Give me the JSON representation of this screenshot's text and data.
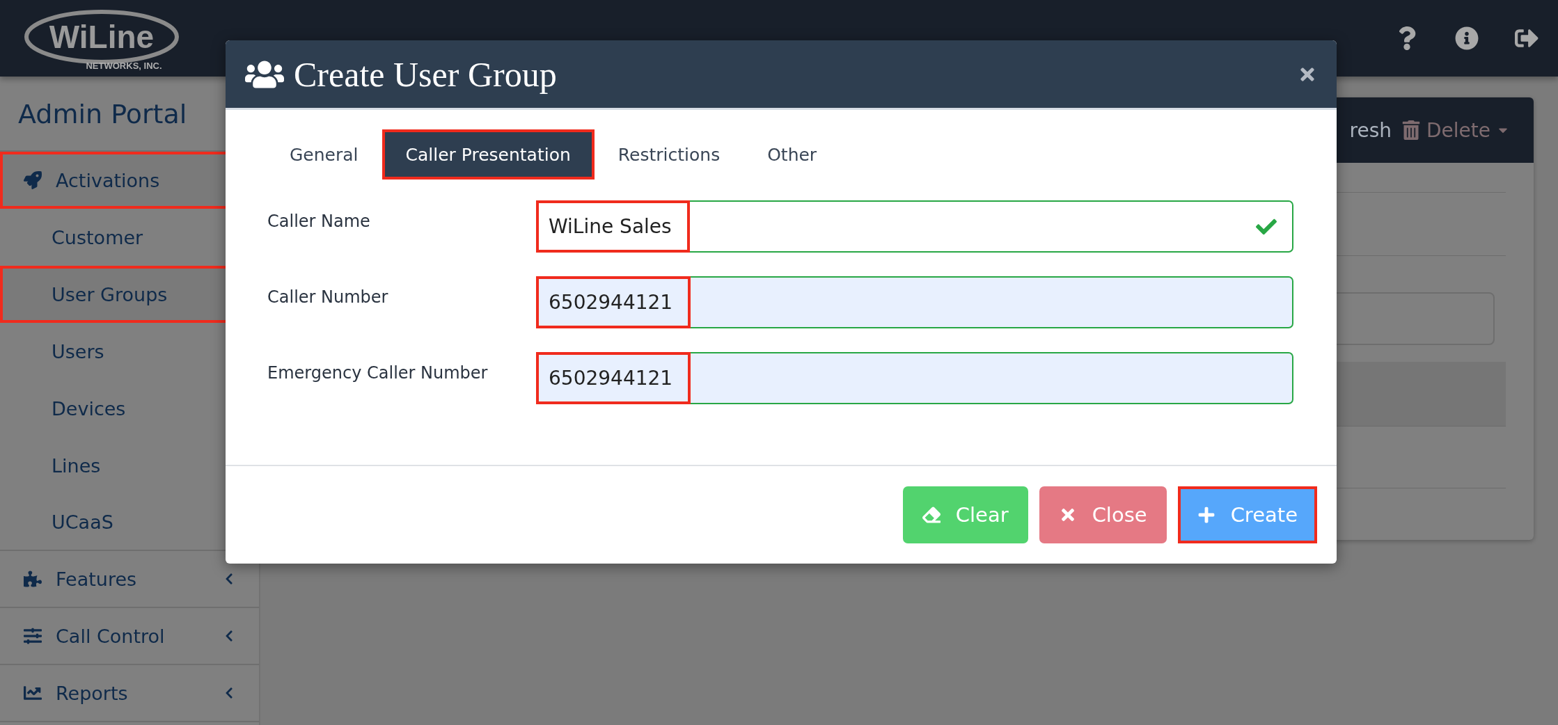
{
  "logo": {
    "name": "WiLine",
    "tagline": "NETWORKS, INC."
  },
  "sidebar": {
    "title": "Admin Portal",
    "items": [
      {
        "label": "Activations",
        "highlighted": true,
        "expandable": false,
        "children": [
          {
            "label": "Customer",
            "highlighted": false
          },
          {
            "label": "User Groups",
            "highlighted": true
          },
          {
            "label": "Users",
            "highlighted": false
          },
          {
            "label": "Devices",
            "highlighted": false
          },
          {
            "label": "Lines",
            "highlighted": false
          },
          {
            "label": "UCaaS",
            "highlighted": false
          }
        ]
      },
      {
        "label": "Features",
        "highlighted": false,
        "expandable": true
      },
      {
        "label": "Call Control",
        "highlighted": false,
        "expandable": true
      },
      {
        "label": "Reports",
        "highlighted": false,
        "expandable": true
      }
    ]
  },
  "background_card": {
    "toolbar": [
      {
        "label": "resh",
        "kind": "text"
      },
      {
        "label": "Delete",
        "kind": "dropdown"
      }
    ]
  },
  "dialog": {
    "title": "Create User Group",
    "tabs": [
      {
        "label": "General",
        "selected": false,
        "highlighted": false
      },
      {
        "label": "Caller Presentation",
        "selected": true,
        "highlighted": true
      },
      {
        "label": "Restrictions",
        "selected": false,
        "highlighted": false
      },
      {
        "label": "Other",
        "selected": false,
        "highlighted": false
      }
    ],
    "fields": [
      {
        "label": "Caller Name",
        "value": "WiLine Sales",
        "valid": true,
        "autofilled": false,
        "highlighted": true
      },
      {
        "label": "Caller Number",
        "value": "6502944121",
        "valid": true,
        "autofilled": true,
        "highlighted": true
      },
      {
        "label": "Emergency Caller Number",
        "value": "6502944121",
        "valid": true,
        "autofilled": true,
        "highlighted": true
      }
    ],
    "buttons": [
      {
        "label": "Clear",
        "kind": "clear",
        "highlighted": false
      },
      {
        "label": "Close",
        "kind": "close",
        "highlighted": false
      },
      {
        "label": "Create",
        "kind": "create",
        "highlighted": true
      }
    ]
  }
}
